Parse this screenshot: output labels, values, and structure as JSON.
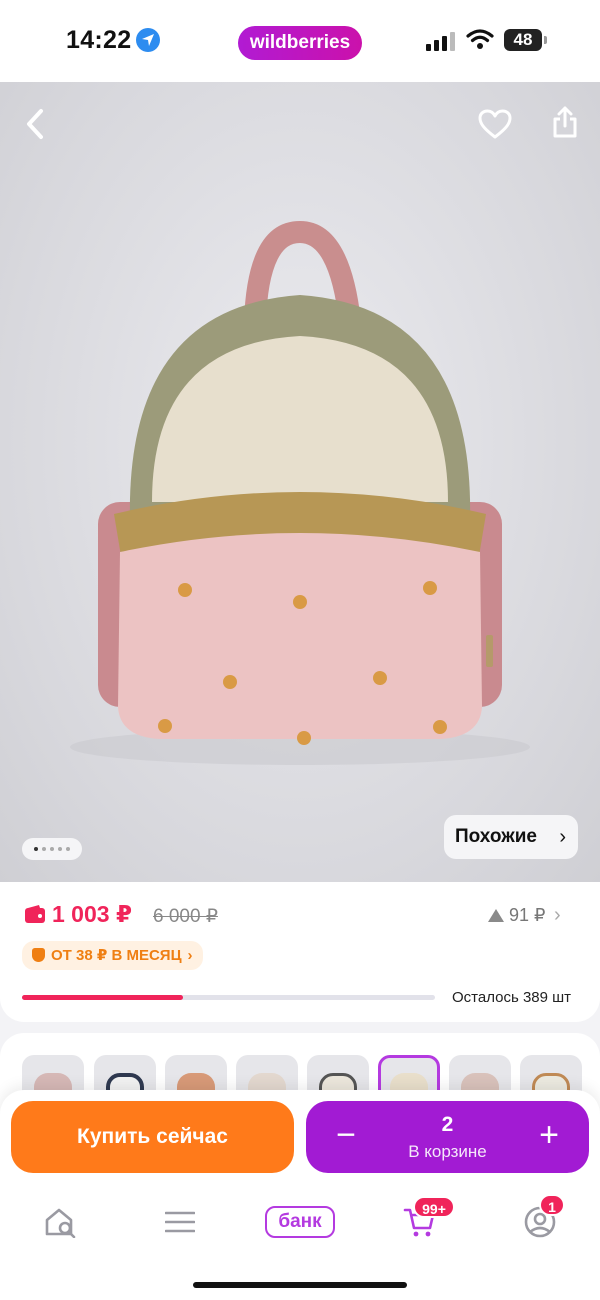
{
  "status_bar": {
    "time": "14:22",
    "brand": "wildberries",
    "battery": "48",
    "icons": [
      "location-arrow-icon",
      "signal-icon",
      "wifi-icon",
      "battery-icon"
    ]
  },
  "product_photo": {
    "similar_label": "Похожие",
    "page_count": 5,
    "active_page": 1,
    "icons": [
      "back-arrow-icon",
      "heart-icon",
      "share-icon"
    ]
  },
  "price_block": {
    "price": "1 003 ₽",
    "old_price": "6 000 ₽",
    "price_change": "91 ₽",
    "installment": "ОТ 38 ₽ В МЕСЯЦ",
    "stock_fraction": 0.39,
    "stock_label": "Осталось 389 шт"
  },
  "actions": {
    "buy_now": "Купить сейчас",
    "cart_quantity": "2",
    "cart_label": "В корзине"
  },
  "tab_bar": {
    "bank_label": "банк",
    "cart_badge": "99+",
    "profile_badge": "1",
    "icons": [
      "home-search-icon",
      "menu-icon",
      "cart-icon",
      "profile-icon"
    ]
  },
  "colors": {
    "brand_purple": "#a21bd3",
    "price_red": "#f0245a",
    "buy_orange": "#ff7a1a"
  }
}
